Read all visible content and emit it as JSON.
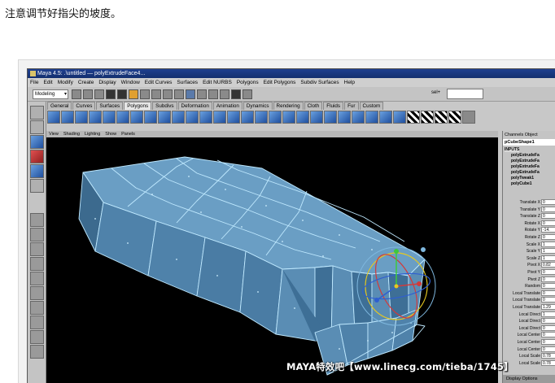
{
  "caption": "注意调节好指尖的坡度。",
  "window": {
    "title": "Maya 4.5: .\\untitled  —  polyExtrudeFace4..."
  },
  "menubar": [
    "File",
    "Edit",
    "Modify",
    "Create",
    "Display",
    "Window",
    "Edit Curves",
    "Surfaces",
    "Edit NURBS",
    "Polygons",
    "Edit Polygons",
    "Subdiv Surfaces",
    "Help"
  ],
  "toolbar": {
    "mode": "Modeling",
    "sel_label": "sel+"
  },
  "shelf_tabs": [
    {
      "label": "General",
      "active": false
    },
    {
      "label": "Curves",
      "active": false
    },
    {
      "label": "Surfaces",
      "active": false
    },
    {
      "label": "Polygons",
      "active": true
    },
    {
      "label": "Subdivs",
      "active": false
    },
    {
      "label": "Deformation",
      "active": false
    },
    {
      "label": "Animation",
      "active": false
    },
    {
      "label": "Dynamics",
      "active": false
    },
    {
      "label": "Rendering",
      "active": false
    },
    {
      "label": "Cloth",
      "active": false
    },
    {
      "label": "Fluids",
      "active": false
    },
    {
      "label": "Fur",
      "active": false
    },
    {
      "label": "Custom",
      "active": false
    }
  ],
  "viewport_menu": [
    "View",
    "Shading",
    "Lighting",
    "Show",
    "Panels"
  ],
  "channel_box": {
    "header": "Channels  Object",
    "object": "pCubeShape1",
    "inputs_title": "INPUTS",
    "inputs": [
      "polyExtrudeFa",
      "polyExtrudeFa",
      "polyExtrudeFa",
      "polyExtrudeFa",
      "polyTweak1",
      "polyCube1"
    ],
    "attributes": [
      {
        "label": "Translate X",
        "value": "0"
      },
      {
        "label": "Translate Y",
        "value": "0"
      },
      {
        "label": "Translate Z",
        "value": "0"
      },
      {
        "label": "Rotate X",
        "value": "0"
      },
      {
        "label": "Rotate Y",
        "value": "-14."
      },
      {
        "label": "Rotate Z",
        "value": "0"
      },
      {
        "label": "Scale X",
        "value": "1"
      },
      {
        "label": "Scale Y",
        "value": "1"
      },
      {
        "label": "Scale Z",
        "value": "1"
      },
      {
        "label": "Pivot X",
        "value": "0.82"
      },
      {
        "label": "Pivot Y",
        "value": "0"
      },
      {
        "label": "Pivot Z",
        "value": "0"
      },
      {
        "label": "Random",
        "value": "0"
      },
      {
        "label": "Local Translate",
        "value": "0"
      },
      {
        "label": "Local Translate",
        "value": "0"
      },
      {
        "label": "Local Translate",
        "value": "1.29"
      },
      {
        "label": "Local Direct",
        "value": "1"
      },
      {
        "label": "Local Direct",
        "value": "0"
      },
      {
        "label": "Local Direct",
        "value": "0"
      },
      {
        "label": "Local Center",
        "value": "0"
      },
      {
        "label": "Local Center",
        "value": "0"
      },
      {
        "label": "Local Center",
        "value": "0"
      },
      {
        "label": "Local Scale",
        "value": "0.78"
      },
      {
        "label": "Local Scale",
        "value": "0.78"
      }
    ],
    "footer": "Display Options"
  },
  "watermark": "MAYA特效吧【www.linecg.com/tieba/1745】",
  "colors": {
    "mesh_face": "#6a9ec4",
    "mesh_edge": "#bfe9ff",
    "viewport_bg": "#000000",
    "title_bar": "#1f3f8f"
  }
}
